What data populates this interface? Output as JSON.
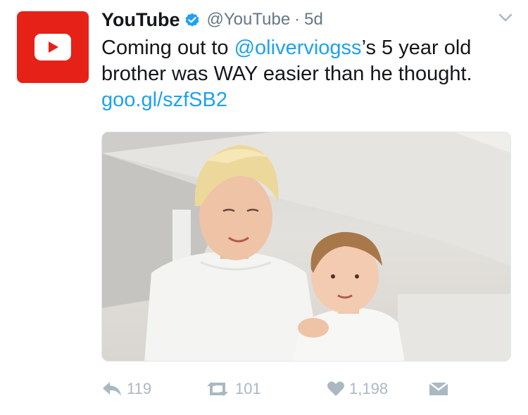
{
  "tweet": {
    "display_name": "YouTube",
    "handle": "@YouTube",
    "separator": "·",
    "time": "5d",
    "text_line1_prefix": "Coming out to ",
    "mention": "@oliverviogss",
    "text_line1_suffix": "’s 5 year old",
    "text_line2": "brother was WAY easier than he thought.",
    "link": "goo.gl/szfSB2"
  },
  "actions": {
    "reply_count": "119",
    "retweet_count": "101",
    "like_count": "1,198"
  },
  "colors": {
    "brand_red": "#e62117",
    "link_blue": "#1da1f2",
    "muted_gray": "#657786",
    "action_gray": "#aab8c2"
  },
  "icons": {
    "avatar": "youtube-play-logo",
    "verified": "verified-badge-icon",
    "caret": "chevron-down-icon",
    "reply": "reply-icon",
    "retweet": "retweet-icon",
    "like": "heart-icon",
    "dm": "envelope-icon"
  }
}
